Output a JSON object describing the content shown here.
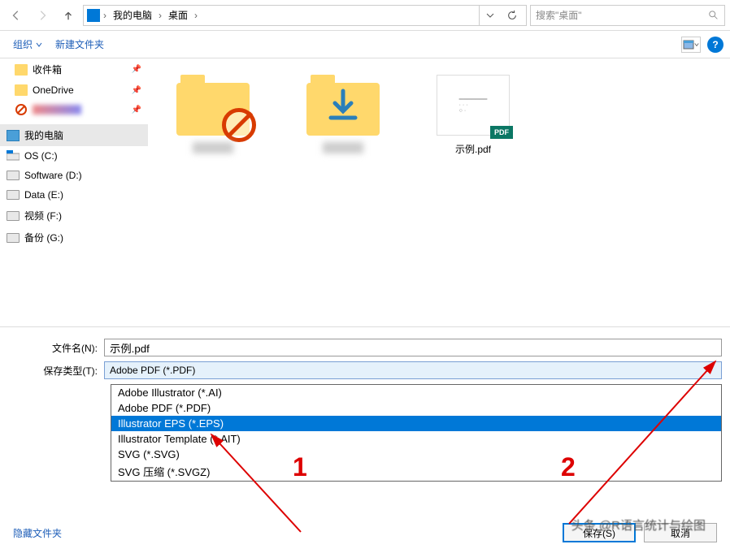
{
  "breadcrumb": {
    "items": [
      "我的电脑",
      "桌面"
    ]
  },
  "search": {
    "placeholder": "搜索\"桌面\""
  },
  "toolbar": {
    "organize": "组织",
    "new_folder": "新建文件夹"
  },
  "sidebar": {
    "quick_access": [
      {
        "label": "收件箱",
        "type": "folder"
      },
      {
        "label": "OneDrive",
        "type": "onedrive"
      }
    ],
    "computer_header": "我的电脑",
    "drives": [
      {
        "label": "OS (C:)"
      },
      {
        "label": "Software (D:)"
      },
      {
        "label": "Data (E:)"
      },
      {
        "label": "视频 (F:)"
      },
      {
        "label": "备份 (G:)"
      }
    ]
  },
  "files": {
    "items": [
      {
        "name": "",
        "type": "folder-restricted"
      },
      {
        "name": "",
        "type": "folder-download"
      },
      {
        "name": "示例.pdf",
        "type": "pdf"
      }
    ]
  },
  "form": {
    "filename_label": "文件名(N):",
    "filename_value": "示例.pdf",
    "filetype_label": "保存类型(T):",
    "filetype_value": "Adobe PDF (*.PDF)"
  },
  "dropdown": {
    "options": [
      "Adobe Illustrator (*.AI)",
      "Adobe PDF (*.PDF)",
      "Illustrator EPS (*.EPS)",
      "Illustrator Template (*.AIT)",
      "SVG (*.SVG)",
      "SVG 压缩 (*.SVGZ)"
    ],
    "selected_index": 2
  },
  "footer": {
    "hide_folders": "隐藏文件夹",
    "save": "保存(S)",
    "cancel": "取消"
  },
  "annotations": {
    "label1": "1",
    "label2": "2"
  },
  "watermark": "头条 @R语言统计与绘图"
}
